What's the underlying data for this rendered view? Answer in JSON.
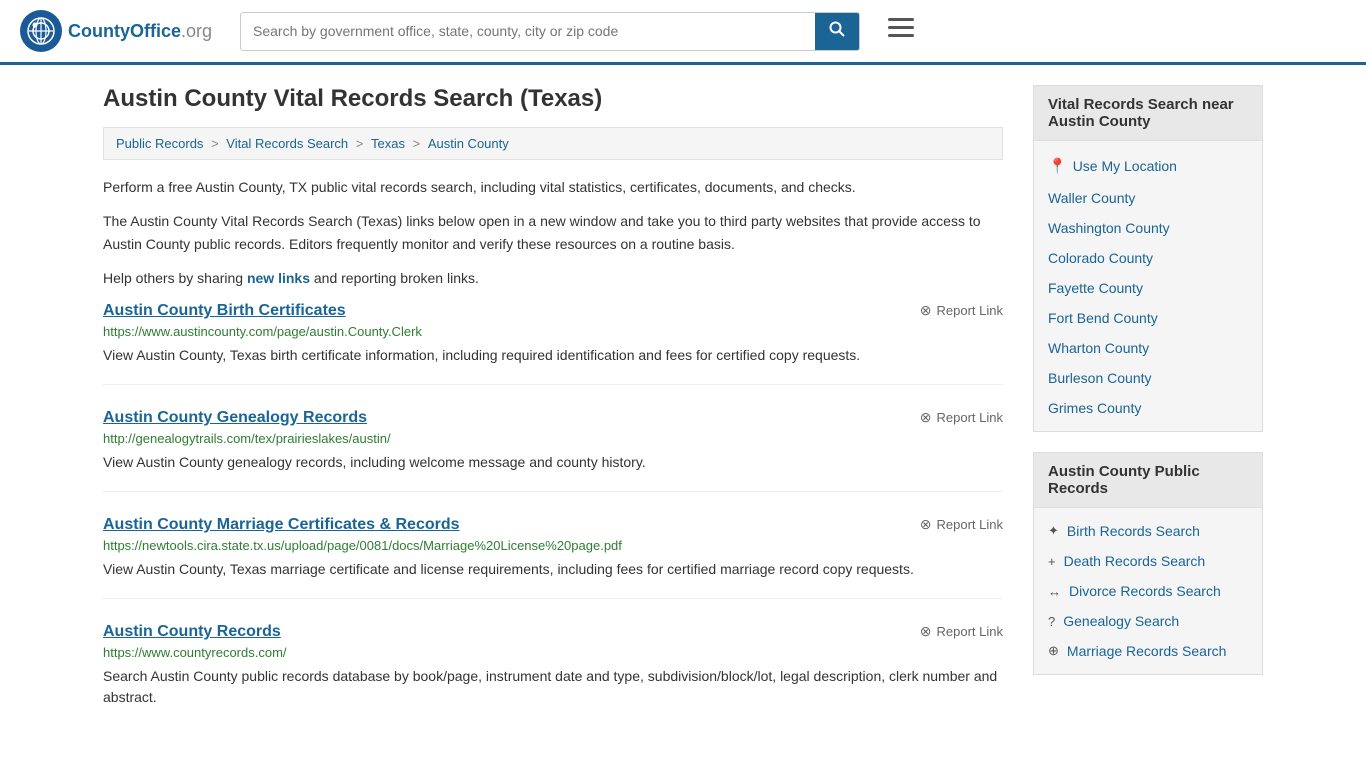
{
  "header": {
    "logo_text": "CountyOffice",
    "logo_suffix": ".org",
    "search_placeholder": "Search by government office, state, county, city or zip code"
  },
  "page": {
    "title": "Austin County Vital Records Search (Texas)",
    "breadcrumbs": [
      {
        "label": "Public Records",
        "href": "#"
      },
      {
        "label": "Vital Records Search",
        "href": "#"
      },
      {
        "label": "Texas",
        "href": "#"
      },
      {
        "label": "Austin County",
        "href": "#"
      }
    ],
    "intro1": "Perform a free Austin County, TX public vital records search, including vital statistics, certificates, documents, and checks.",
    "intro2": "The Austin County Vital Records Search (Texas) links below open in a new window and take you to third party websites that provide access to Austin County public records. Editors frequently monitor and verify these resources on a routine basis.",
    "intro3_pre": "Help others by sharing ",
    "intro3_link": "new links",
    "intro3_post": " and reporting broken links.",
    "records": [
      {
        "title": "Austin County Birth Certificates",
        "url": "https://www.austincounty.com/page/austin.County.Clerk",
        "description": "View Austin County, Texas birth certificate information, including required identification and fees for certified copy requests.",
        "report": "Report Link"
      },
      {
        "title": "Austin County Genealogy Records",
        "url": "http://genealogytrails.com/tex/prairieslakes/austin/",
        "description": "View Austin County genealogy records, including welcome message and county history.",
        "report": "Report Link"
      },
      {
        "title": "Austin County Marriage Certificates & Records",
        "url": "https://newtools.cira.state.tx.us/upload/page/0081/docs/Marriage%20License%20page.pdf",
        "description": "View Austin County, Texas marriage certificate and license requirements, including fees for certified marriage record copy requests.",
        "report": "Report Link"
      },
      {
        "title": "Austin County Records",
        "url": "https://www.countyrecords.com/",
        "description": "Search Austin County public records database by book/page, instrument date and type, subdivision/block/lot, legal description, clerk number and abstract.",
        "report": "Report Link"
      }
    ]
  },
  "sidebar": {
    "nearby_title": "Vital Records Search near Austin County",
    "use_location": "Use My Location",
    "nearby_counties": [
      "Waller County",
      "Washington County",
      "Colorado County",
      "Fayette County",
      "Fort Bend County",
      "Wharton County",
      "Burleson County",
      "Grimes County"
    ],
    "public_records_title": "Austin County Public Records",
    "public_records_items": [
      {
        "icon": "✦",
        "label": "Birth Records Search"
      },
      {
        "icon": "+",
        "label": "Death Records Search"
      },
      {
        "icon": "↔",
        "label": "Divorce Records Search"
      },
      {
        "icon": "?",
        "label": "Genealogy Search"
      },
      {
        "icon": "⊕",
        "label": "Marriage Records Search"
      }
    ]
  }
}
